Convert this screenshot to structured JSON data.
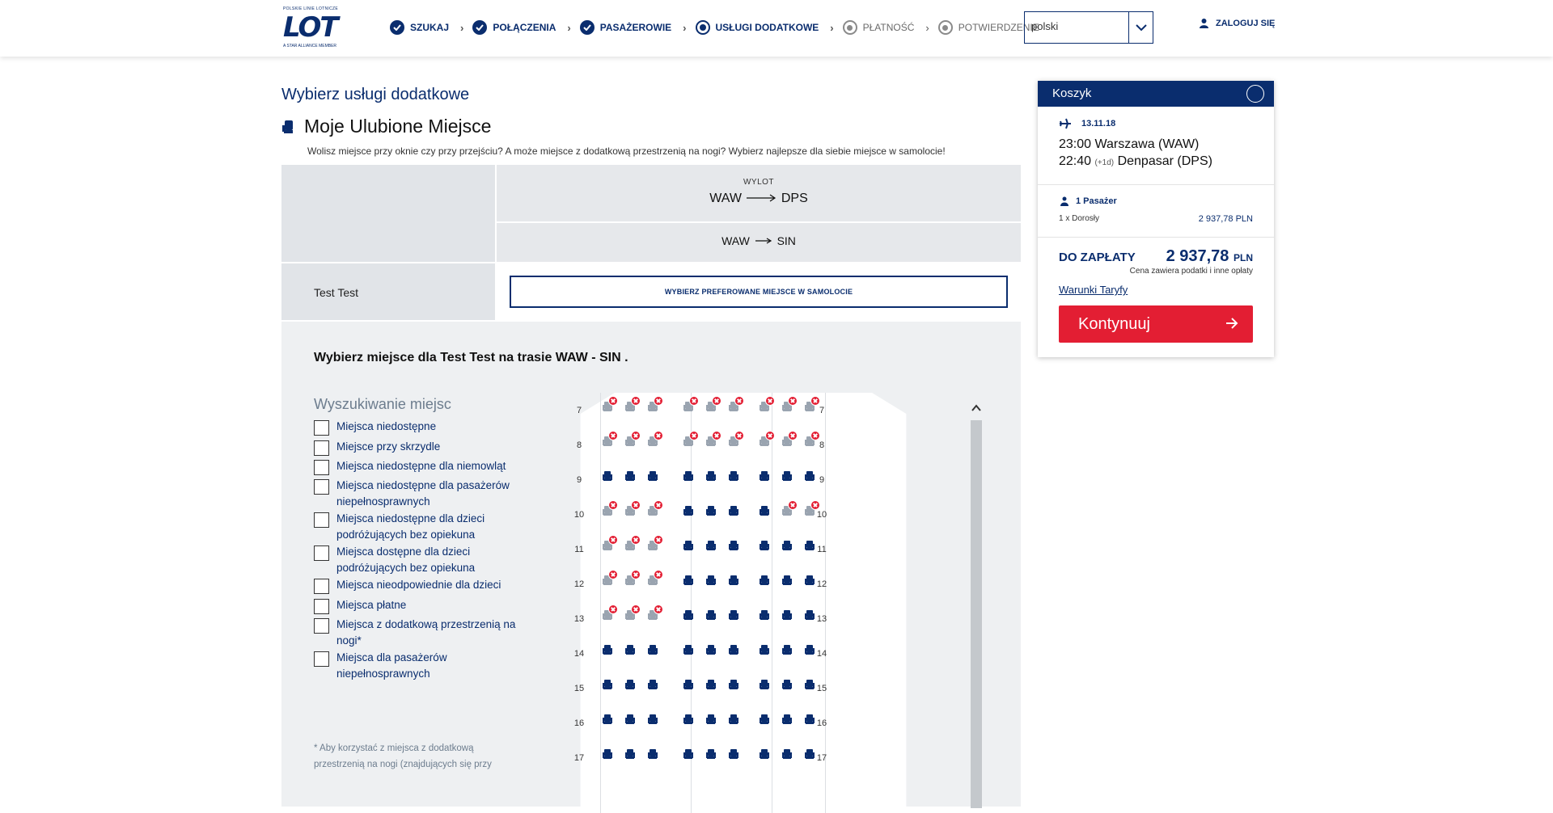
{
  "header": {
    "logo_small": "POLSKIE LINIE LOTNICZE",
    "logo_text": "LOT",
    "logo_member": "A STAR ALLIANCE MEMBER",
    "steps": [
      {
        "label": "SZUKAJ",
        "state": "done"
      },
      {
        "label": "POŁĄCZENIA",
        "state": "done"
      },
      {
        "label": "PASAŻEROWIE",
        "state": "done"
      },
      {
        "label": "USŁUGI DODATKOWE",
        "state": "current"
      },
      {
        "label": "PŁATNOŚĆ",
        "state": "todo"
      },
      {
        "label": "POTWIERDZENIE",
        "state": "todo"
      }
    ],
    "language": "polski",
    "login_label": "ZALOGUJ SIĘ"
  },
  "page": {
    "heading": "Wybierz usługi dodatkowe",
    "section_title": "Moje Ulubione Miejsce",
    "description": "Wolisz miejsce przy oknie czy przy przejściu? A może miejsce z dodatkową przestrzenią na nogi? Wybierz najlepsze dla siebie miejsce w samolocie!"
  },
  "flight": {
    "direction_label": "WYLOT",
    "route_from": "WAW",
    "route_to": "DPS",
    "segment_from": "WAW",
    "segment_to": "SIN",
    "passenger_name": "Test Test",
    "pref_button": "WYBIERZ PREFEROWANE MIEJSCE W SAMOLOCIE"
  },
  "seatmap": {
    "heading": "Wybierz miejsce dla Test Test na trasie WAW - SIN .",
    "filter_heading": "Wyszukiwanie miejsc",
    "filters": [
      "Miejsca niedostępne",
      "Miejsce przy skrzydle",
      "Miejsca niedostępne dla niemowląt",
      "Miejsca niedostępne dla pasażerów niepełnosprawnych",
      "Miejsca niedostępne dla dzieci podróżujących bez opiekuna",
      "Miejsca dostępne dla dzieci podróżujących bez opiekuna",
      "Miejsca nieodpowiednie dla dzieci",
      "Miejsca płatne",
      "Miejsca z dodatkową przestrzenią na nogi*",
      "Miejsca dla pasażerów niepełnosprawnych"
    ],
    "note": "* Aby korzystać z miejsca z dodatkową przestrzenią na nogi (znajdujących się przy",
    "rows": [
      {
        "num": "7",
        "seats": [
          1,
          1,
          1,
          1,
          1,
          1,
          1,
          1,
          1
        ]
      },
      {
        "num": "8",
        "seats": [
          1,
          1,
          1,
          1,
          1,
          1,
          1,
          1,
          1
        ]
      },
      {
        "num": "9",
        "seats": [
          0,
          0,
          0,
          0,
          0,
          0,
          0,
          0,
          0
        ]
      },
      {
        "num": "10",
        "seats": [
          1,
          1,
          1,
          0,
          0,
          0,
          0,
          1,
          1
        ]
      },
      {
        "num": "11",
        "seats": [
          1,
          1,
          1,
          0,
          0,
          0,
          0,
          0,
          0
        ]
      },
      {
        "num": "12",
        "seats": [
          1,
          1,
          1,
          0,
          0,
          0,
          0,
          0,
          0
        ]
      },
      {
        "num": "13",
        "seats": [
          1,
          1,
          1,
          0,
          0,
          0,
          0,
          0,
          0
        ]
      },
      {
        "num": "14",
        "seats": [
          0,
          0,
          0,
          0,
          0,
          0,
          0,
          0,
          0
        ]
      },
      {
        "num": "15",
        "seats": [
          0,
          0,
          0,
          0,
          0,
          0,
          0,
          0,
          0
        ]
      },
      {
        "num": "16",
        "seats": [
          0,
          0,
          0,
          0,
          0,
          0,
          0,
          0,
          0
        ]
      },
      {
        "num": "17",
        "seats": [
          0,
          0,
          0,
          0,
          0,
          0,
          0,
          0,
          0
        ]
      }
    ]
  },
  "cart": {
    "title": "Koszyk",
    "date": "13.11.18",
    "dep_time": "23:00",
    "dep_place": "Warszawa (WAW)",
    "arr_time": "22:40",
    "arr_offset": "(+1d)",
    "arr_place": "Denpasar (DPS)",
    "pax_count": "1 Pasażer",
    "pax_type": "1 x Dorosły",
    "pax_price": "2 937,78 PLN",
    "due_label": "DO ZAPŁATY",
    "due_amount": "2 937,78",
    "due_currency": "PLN",
    "due_note": "Cena zawiera podatki i inne opłaty",
    "terms": "Warunki Taryfy",
    "continue": "Kontynuuj"
  },
  "colors": {
    "brand": "#0a2d6e",
    "accent": "#e31e33"
  }
}
